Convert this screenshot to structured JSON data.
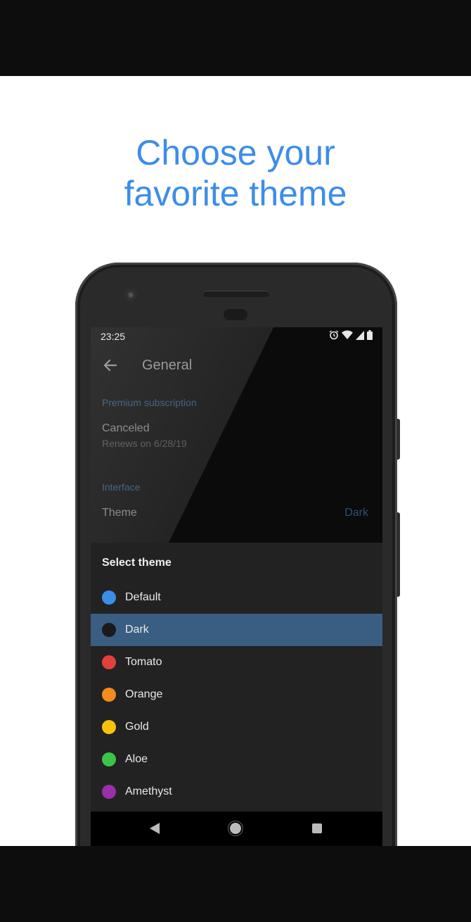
{
  "headline": {
    "line1": "Choose your",
    "line2": "favorite theme"
  },
  "status": {
    "time": "23:25"
  },
  "toolbar": {
    "title": "General"
  },
  "sections": {
    "premium_label": "Premium subscription",
    "subscription_status": "Canceled",
    "renewal_text": "Renews on 6/28/19",
    "interface_label": "Interface",
    "theme_title": "Theme",
    "theme_value": "Dark"
  },
  "sheet": {
    "title": "Select theme",
    "selected": "Dark",
    "options": [
      {
        "label": "Default",
        "color": "#3a8ee6"
      },
      {
        "label": "Dark",
        "color": "#1a1a1a"
      },
      {
        "label": "Tomato",
        "color": "#e2403c"
      },
      {
        "label": "Orange",
        "color": "#f28c1c"
      },
      {
        "label": "Gold",
        "color": "#f6c20e"
      },
      {
        "label": "Aloe",
        "color": "#3cc447"
      },
      {
        "label": "Amethyst",
        "color": "#9a2faa"
      }
    ]
  },
  "icons": {
    "back": "arrow-back-icon",
    "alarm": "alarm-icon",
    "wifi": "wifi-icon",
    "signal": "signal-icon",
    "battery": "battery-icon",
    "nav_back": "nav-back-icon",
    "nav_home": "nav-home-icon",
    "nav_recent": "nav-recent-icon"
  }
}
